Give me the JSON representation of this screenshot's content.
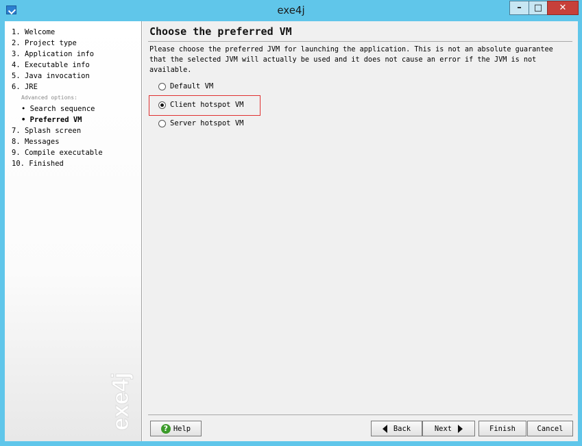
{
  "window": {
    "title": "exe4j"
  },
  "sidebar": {
    "steps": [
      "1. Welcome",
      "2. Project type",
      "3. Application info",
      "4. Executable info",
      "5. Java invocation",
      "6. JRE",
      "Advanced options:",
      "• Search sequence",
      "• Preferred VM",
      "7. Splash screen",
      "8. Messages",
      "9. Compile executable",
      "10. Finished"
    ],
    "watermark": "exe4j"
  },
  "content": {
    "heading": "Choose the preferred VM",
    "description": "Please choose the preferred JVM for launching the application. This is not an absolute guarantee that the selected JVM will actually be used and it does not cause an error if the JVM is not available.",
    "options": [
      {
        "label": "Default VM",
        "checked": false
      },
      {
        "label": "Client hotspot VM",
        "checked": true
      },
      {
        "label": "Server hotspot VM",
        "checked": false
      }
    ]
  },
  "buttons": {
    "help": "Help",
    "back": "Back",
    "next": "Next",
    "finish": "Finish",
    "cancel": "Cancel"
  }
}
